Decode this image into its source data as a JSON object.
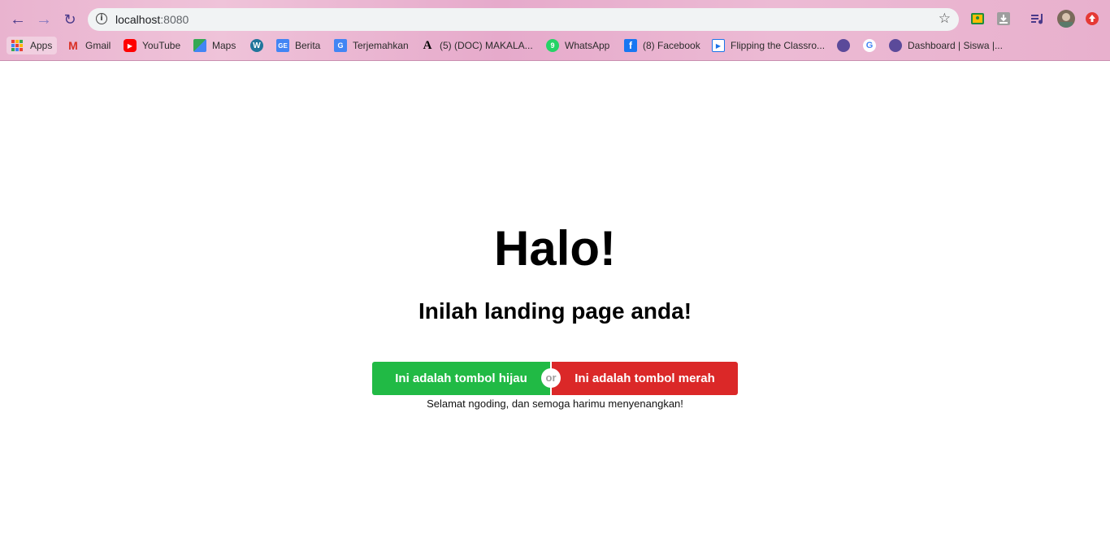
{
  "browser": {
    "url_host": "localhost",
    "url_port": ":8080",
    "bookmarks": [
      {
        "label": "Apps",
        "icon": "apps-grid-icon"
      },
      {
        "label": "Gmail",
        "icon": "gmail-icon"
      },
      {
        "label": "YouTube",
        "icon": "youtube-icon"
      },
      {
        "label": "Maps",
        "icon": "maps-icon"
      },
      {
        "label": "",
        "icon": "wordpress-icon"
      },
      {
        "label": "Berita",
        "icon": "news-icon"
      },
      {
        "label": "Terjemahkan",
        "icon": "translate-icon"
      },
      {
        "label": "(5) (DOC) MAKALA...",
        "icon": "academia-icon"
      },
      {
        "label": "WhatsApp",
        "icon": "whatsapp-icon"
      },
      {
        "label": "(8) Facebook",
        "icon": "facebook-icon"
      },
      {
        "label": "Flipping the Classro...",
        "icon": "video-icon"
      },
      {
        "label": "",
        "icon": "globe-icon"
      },
      {
        "label": "",
        "icon": "google-icon"
      },
      {
        "label": "Dashboard | Siswa |...",
        "icon": "globe-icon"
      }
    ]
  },
  "page": {
    "title": "Halo!",
    "subtitle": "Inilah landing page anda!",
    "green_button": "Ini adalah tombol hijau",
    "or_label": "or",
    "red_button": "Ini adalah tombol merah",
    "footer_text": "Selamat ngoding, dan semoga harimu menyenangkan!"
  },
  "colors": {
    "green": "#21ba45",
    "red": "#db2828",
    "chrome_pink": "#e9b3cf"
  }
}
